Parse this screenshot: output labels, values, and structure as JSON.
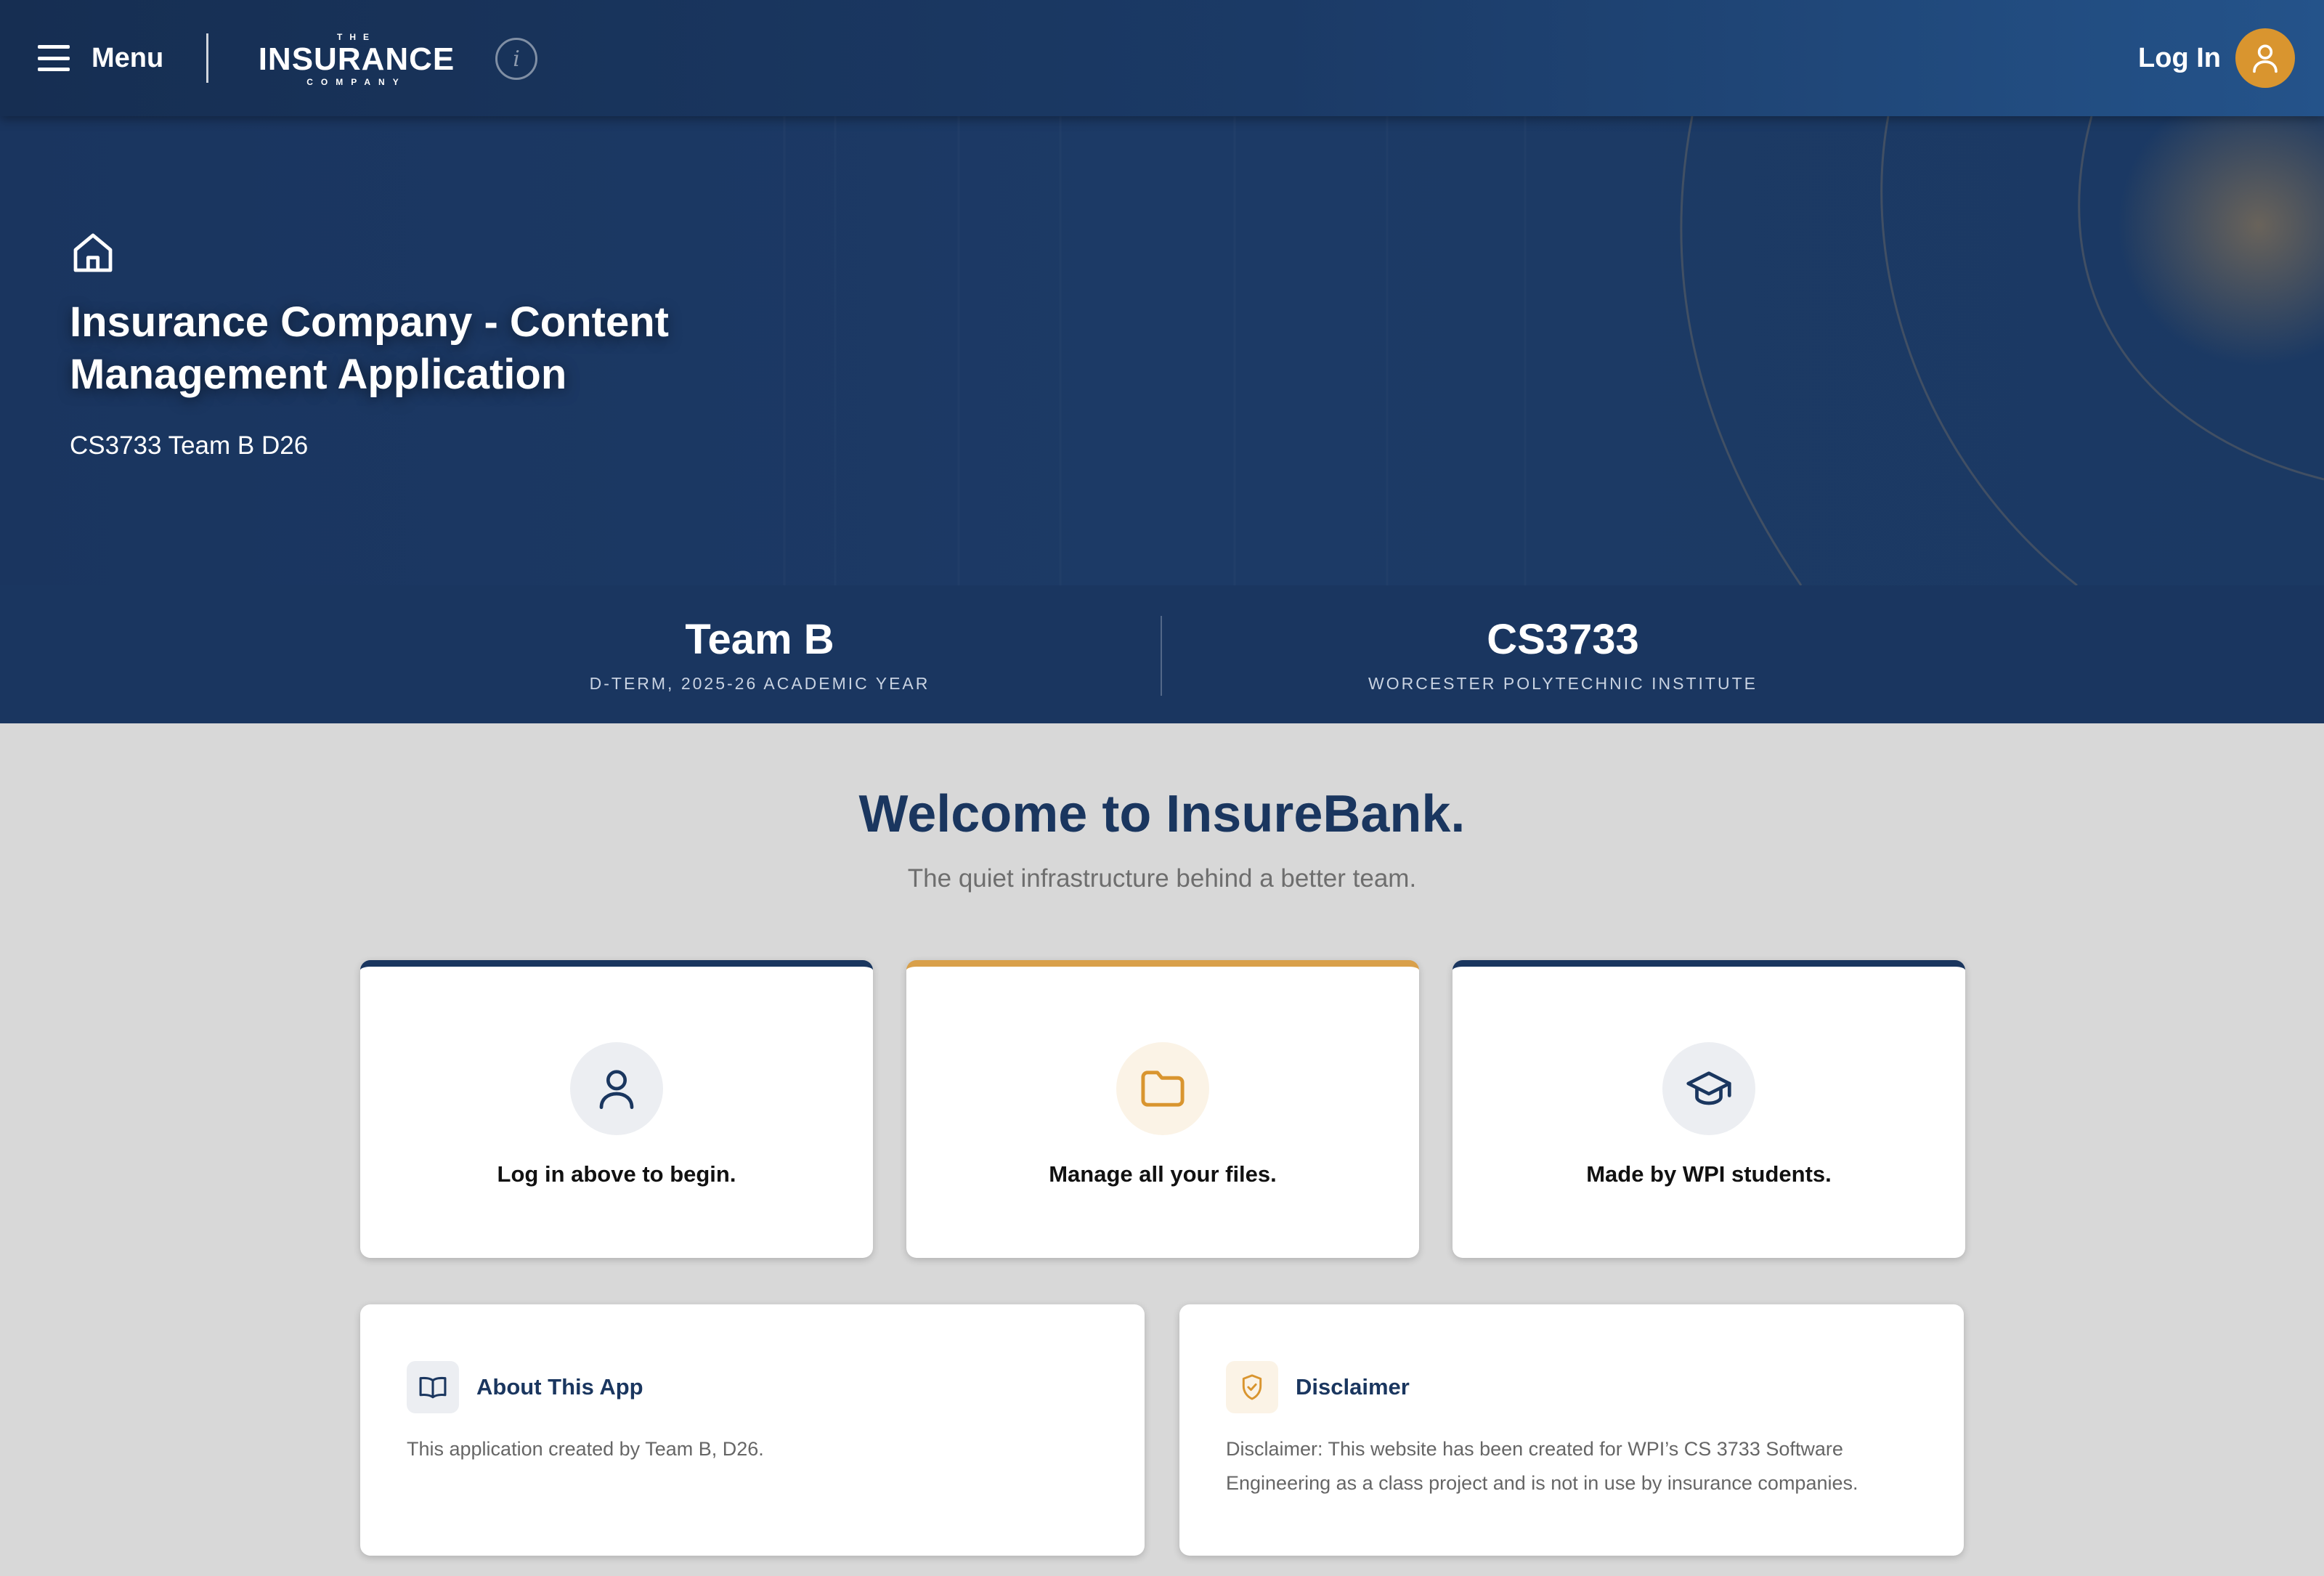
{
  "nav": {
    "menu_label": "Menu",
    "logo": {
      "top": "THE",
      "main": "INSURANCE",
      "bottom": "COMPANY"
    },
    "info_icon": "info-icon",
    "login_label": "Log In",
    "login_icon": "user-icon"
  },
  "hero": {
    "icon": "home-icon",
    "title": "Insurance Company - Content Management Application",
    "subtitle": "CS3733 Team B D26"
  },
  "stats": [
    {
      "title": "Team B",
      "caption": "D-TERM, 2025-26 ACADEMIC YEAR"
    },
    {
      "title": "CS3733",
      "caption": "WORCESTER POLYTECHNIC INSTITUTE"
    }
  ],
  "welcome": {
    "title": "Welcome to InsureBank.",
    "tagline": "The quiet infrastructure behind a better team."
  },
  "features": [
    {
      "label": "Log in above to begin.",
      "icon": "user-icon",
      "accent": "#1a365f"
    },
    {
      "label": "Manage all your files.",
      "icon": "folder-icon",
      "accent": "#d9a04a"
    },
    {
      "label": "Made by WPI students.",
      "icon": "graduation-cap-icon",
      "accent": "#1a365f"
    }
  ],
  "info_cards": [
    {
      "title": "About This App",
      "icon": "book-icon",
      "body": "This application created by Team B, D26."
    },
    {
      "title": "Disclaimer",
      "icon": "shield-check-icon",
      "body": "Disclaimer: This website has been created for WPI’s CS 3733 Software Engineering as a class project and is not in use by insurance companies."
    }
  ],
  "colors": {
    "navy": "#1a365f",
    "gold": "#d9952f",
    "background": "#d8d8d8"
  }
}
